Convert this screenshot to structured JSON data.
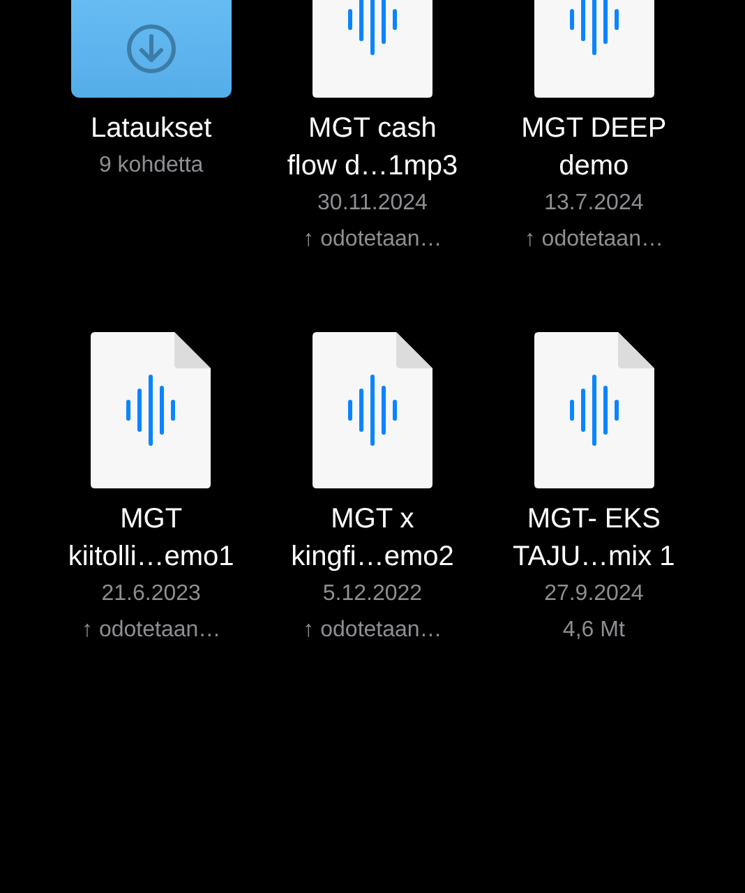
{
  "items": [
    {
      "kind": "folder",
      "name": [
        "Lataukset"
      ],
      "details": [
        "9 kohdetta"
      ]
    },
    {
      "kind": "audio",
      "name": [
        "MGT cash",
        "flow d…1mp3"
      ],
      "details": [
        "30.11.2024",
        "↑ odotetaan…"
      ]
    },
    {
      "kind": "audio",
      "name": [
        "MGT DEEP",
        "demo"
      ],
      "details": [
        "13.7.2024",
        "↑ odotetaan…"
      ]
    },
    {
      "kind": "audio",
      "name": [
        "MGT",
        "kiitolli…emo1"
      ],
      "details": [
        "21.6.2023",
        "↑ odotetaan…"
      ]
    },
    {
      "kind": "audio",
      "name": [
        "MGT x",
        "kingfi…emo2"
      ],
      "details": [
        "5.12.2022",
        "↑ odotetaan…"
      ]
    },
    {
      "kind": "audio",
      "name": [
        "MGT- EKS",
        "TAJU…mix 1"
      ],
      "details": [
        "27.9.2024",
        "4,6 Mt"
      ]
    }
  ]
}
